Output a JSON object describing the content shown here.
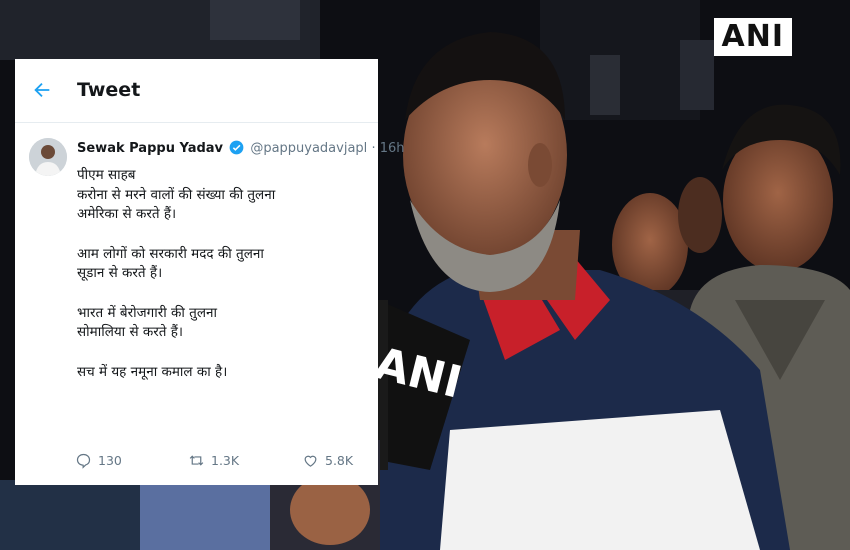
{
  "watermark": {
    "top_logo": "ANI",
    "mic_logo": "ANI"
  },
  "tweet": {
    "header_title": "Tweet",
    "author_name": "Sewak Pappu Yadav",
    "handle": "@pappuyadavjapl",
    "separator": "·",
    "time": "16h",
    "paragraphs": [
      [
        "पीएम साहब",
        "करोना से मरने वालों की संख्या की तुलना",
        "अमेरिका से करते हैं।"
      ],
      [
        "आम लोगों को सरकारी मदद की तुलना",
        "सूडान से करते हैं।"
      ],
      [
        "भारत में बेरोजगारी की तुलना",
        "सोमालिया से करते हैं।"
      ],
      [
        "सच में यह नमूना कमाल का है।"
      ]
    ],
    "replies": "130",
    "retweets": "1.3K",
    "likes": "5.8K"
  },
  "colors": {
    "accent": "#1da1f2",
    "text": "#14171a",
    "muted": "#657786",
    "shirt_red": "#c8202a",
    "shirt_navy": "#1c2a4a"
  }
}
